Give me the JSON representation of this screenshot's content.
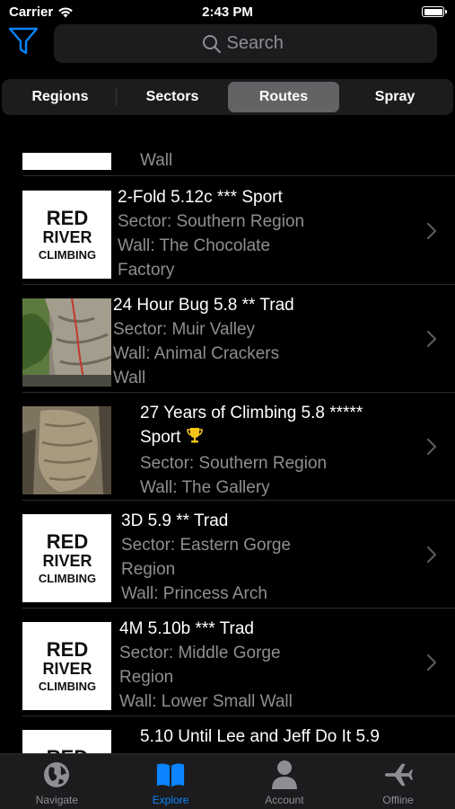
{
  "status": {
    "carrier": "Carrier",
    "time": "2:43 PM"
  },
  "search": {
    "placeholder": "Search"
  },
  "segments": [
    {
      "label": "Regions",
      "active": false
    },
    {
      "label": "Sectors",
      "active": false
    },
    {
      "label": "Routes",
      "active": true
    },
    {
      "label": "Spray",
      "active": false
    }
  ],
  "partial_row": {
    "line": "Wall"
  },
  "routes": [
    {
      "title": "2-Fold 5.12c *** Sport",
      "lines": [
        "Sector: Southern Region",
        "Wall: The Chocolate",
        "Factory"
      ],
      "thumbnail": "logo"
    },
    {
      "title": "24 Hour Bug 5.8 ** Trad",
      "lines": [
        "Sector: Muir Valley",
        "Wall: Animal Crackers",
        "Wall"
      ],
      "thumbnail": "photo-rock-rope"
    },
    {
      "title": "27 Years of Climbing 5.8 *****",
      "title2": "Sport",
      "badge_icon": "trophy-icon",
      "lines": [
        "Sector: Southern Region",
        "Wall: The Gallery"
      ],
      "thumbnail": "photo-rock"
    },
    {
      "title": "3D 5.9 ** Trad",
      "lines": [
        "Sector: Eastern Gorge",
        "Region",
        "Wall: Princess Arch"
      ],
      "thumbnail": "logo"
    },
    {
      "title": "4M 5.10b *** Trad",
      "lines": [
        "Sector: Middle Gorge",
        "Region",
        "Wall: Lower Small Wall"
      ],
      "thumbnail": "logo"
    },
    {
      "title": "5.10 Until Lee and Jeff Do It 5.9",
      "lines": [],
      "thumbnail": "logo"
    }
  ],
  "logo": {
    "line1": "RED",
    "line2": "RIVER",
    "line3": "CLIMBING"
  },
  "tabs": [
    {
      "label": "Navigate",
      "icon": "globe-icon",
      "active": false
    },
    {
      "label": "Explore",
      "icon": "book-icon",
      "active": true
    },
    {
      "label": "Account",
      "icon": "person-icon",
      "active": false
    },
    {
      "label": "Offline",
      "icon": "airplane-icon",
      "active": false
    }
  ],
  "colors": {
    "accent": "#0a84ff",
    "background": "#000000",
    "secondary_text": "#8e8e93",
    "inactive_tab": "#8e8e93"
  }
}
